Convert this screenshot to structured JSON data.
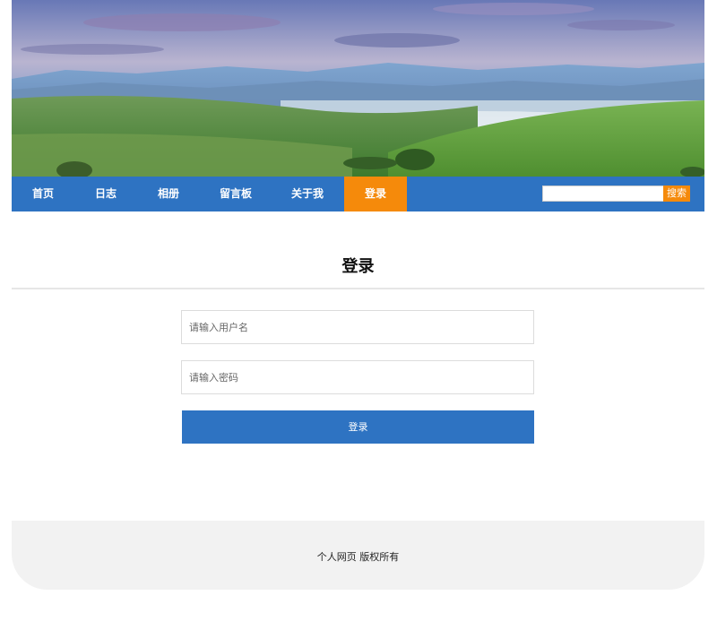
{
  "banner": {
    "image_desc": "landscape-banner-image"
  },
  "nav": {
    "items": [
      {
        "label": "首页"
      },
      {
        "label": "日志"
      },
      {
        "label": "相册"
      },
      {
        "label": "留言板"
      },
      {
        "label": "关于我"
      },
      {
        "label": "登录",
        "active": true
      }
    ],
    "search": {
      "placeholder": "",
      "button_label": "搜索"
    }
  },
  "login": {
    "title": "登录",
    "username_placeholder": "请输入用户名",
    "password_placeholder": "请输入密码",
    "submit_label": "登录"
  },
  "footer": {
    "text": "个人网页 版权所有"
  },
  "colors": {
    "nav_bg": "#2e73c2",
    "active_accent": "#f58a0b",
    "footer_bg": "#f2f2f2"
  }
}
